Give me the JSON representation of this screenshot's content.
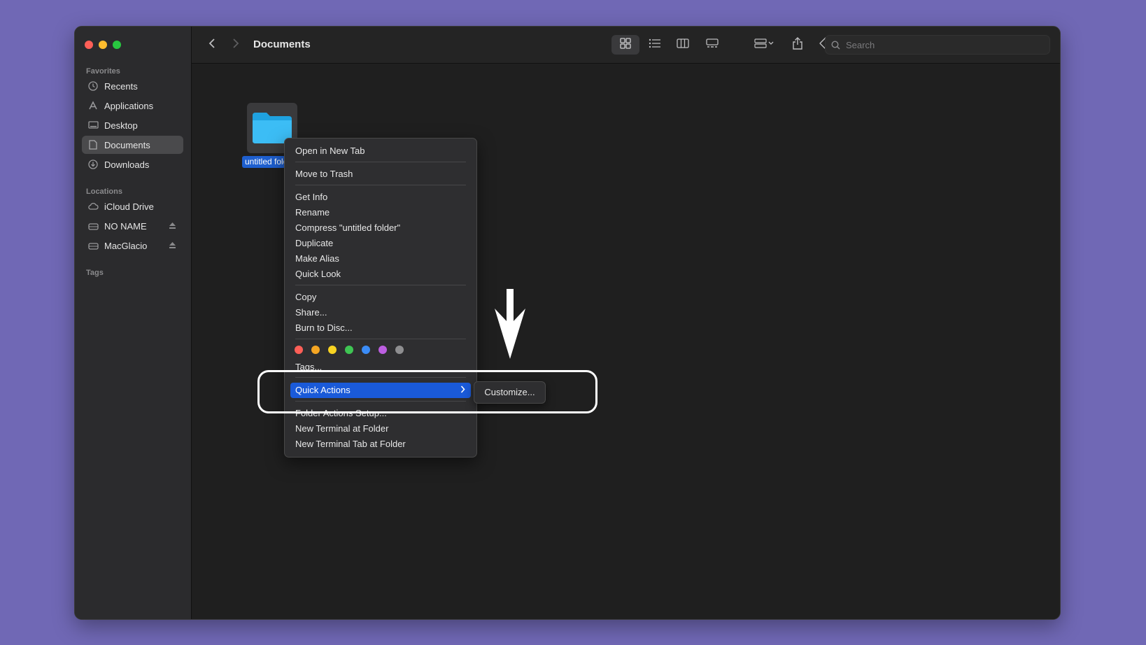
{
  "window": {
    "title": "Documents"
  },
  "sidebar": {
    "favorites_label": "Favorites",
    "favorites": [
      {
        "label": "Recents",
        "icon": "clock-icon"
      },
      {
        "label": "Applications",
        "icon": "applications-icon"
      },
      {
        "label": "Desktop",
        "icon": "desktop-icon"
      },
      {
        "label": "Documents",
        "icon": "document-icon",
        "active": true
      },
      {
        "label": "Downloads",
        "icon": "download-icon"
      }
    ],
    "locations_label": "Locations",
    "locations": [
      {
        "label": "iCloud Drive",
        "icon": "cloud-icon"
      },
      {
        "label": "NO NAME",
        "icon": "drive-icon",
        "eject": true
      },
      {
        "label": "MacGlacio",
        "icon": "drive-icon",
        "eject": true
      }
    ],
    "tags_label": "Tags"
  },
  "search": {
    "placeholder": "Search"
  },
  "folder": {
    "label": "untitled folder"
  },
  "context_menu": {
    "open_new_tab": "Open in New Tab",
    "move_to_trash": "Move to Trash",
    "get_info": "Get Info",
    "rename": "Rename",
    "compress": "Compress \"untitled folder\"",
    "duplicate": "Duplicate",
    "make_alias": "Make Alias",
    "quick_look": "Quick Look",
    "copy": "Copy",
    "share": "Share...",
    "burn": "Burn to Disc...",
    "tag_colors": [
      "#fe5f57",
      "#f5a623",
      "#f8d322",
      "#3fc553",
      "#3b8cf6",
      "#bc5ee0",
      "#8e8e90"
    ],
    "tags": "Tags...",
    "quick_actions": "Quick Actions",
    "folder_actions_setup": "Folder Actions Setup...",
    "new_terminal": "New Terminal at Folder",
    "new_terminal_tab": "New Terminal Tab at Folder"
  },
  "submenu": {
    "customize": "Customize..."
  },
  "colors": {
    "accent": "#1a5ad9",
    "background": "#7068b5"
  }
}
